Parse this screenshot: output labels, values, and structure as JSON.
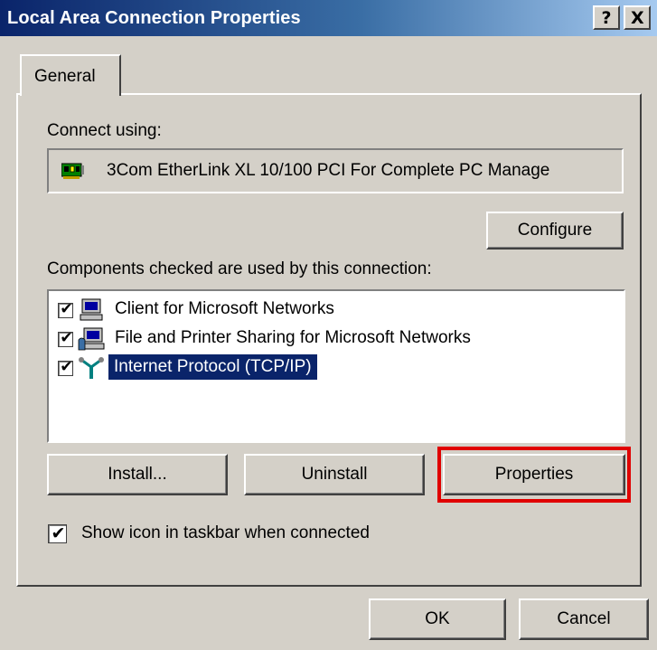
{
  "window": {
    "title": "Local Area Connection Properties",
    "help_button": "?",
    "close_button": "X"
  },
  "tabs": [
    {
      "label": "General",
      "active": true
    }
  ],
  "connect_using": {
    "label": "Connect using:",
    "adapter_name": "3Com EtherLink XL 10/100 PCI For Complete PC Manage",
    "adapter_icon": "network-card-icon",
    "configure_label": "Configure"
  },
  "components": {
    "label": "Components checked are used by this connection:",
    "items": [
      {
        "label": "Client for Microsoft Networks",
        "checked": true,
        "icon": "computer-icon",
        "selected": false
      },
      {
        "label": "File and Printer Sharing for Microsoft Networks",
        "checked": true,
        "icon": "shared-computer-icon",
        "selected": false
      },
      {
        "label": "Internet Protocol (TCP/IP)",
        "checked": true,
        "icon": "network-protocol-icon",
        "selected": true
      }
    ],
    "install_label": "Install...",
    "uninstall_label": "Uninstall",
    "properties_label": "Properties"
  },
  "show_icon": {
    "label": "Show icon in taskbar when connected",
    "checked": true
  },
  "footer": {
    "ok_label": "OK",
    "cancel_label": "Cancel"
  },
  "colors": {
    "titlebar": "#0a246a",
    "selection": "#0a246a",
    "annotation": "#e00000",
    "face": "#d4d0c8"
  }
}
